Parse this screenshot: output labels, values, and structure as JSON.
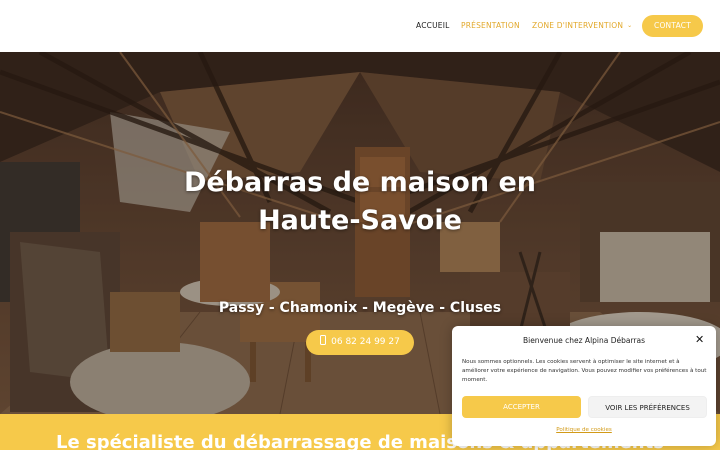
{
  "nav": {
    "items": [
      {
        "label": "ACCUEIL"
      },
      {
        "label": "PRÉSENTATION"
      },
      {
        "label": "ZONE D'INTERVENTION"
      }
    ],
    "contact_label": "CONTACT"
  },
  "hero": {
    "title_line1": "Débarras de maison en",
    "title_line2": "Haute-Savoie",
    "subtitle": "Passy - Chamonix - Megève - Cluses",
    "phone_label": "06 82 24 99 27"
  },
  "band": {
    "title": "Le spécialiste du débarrassage de maisons & appartements"
  },
  "cookie": {
    "title": "Bienvenue chez Alpina Débarras",
    "text": "Nous sommes optionnels. Les cookies servent à optimiser le site internet et à améliorer votre expérience de navigation. Vous pouvez modifier vos préférences à tout moment.",
    "accept_label": "ACCEPTER",
    "prefs_label": "VOIR LES PRÉFÉRENCES",
    "policy_label": "Politique de cookies"
  },
  "colors": {
    "accent": "#f6c94a",
    "nav_link": "#e2a82a",
    "nav_active": "#1d1d1d"
  },
  "icons": {
    "dropdown": "chevron-down-icon",
    "phone": "mobile-phone-icon",
    "close": "close-icon"
  }
}
